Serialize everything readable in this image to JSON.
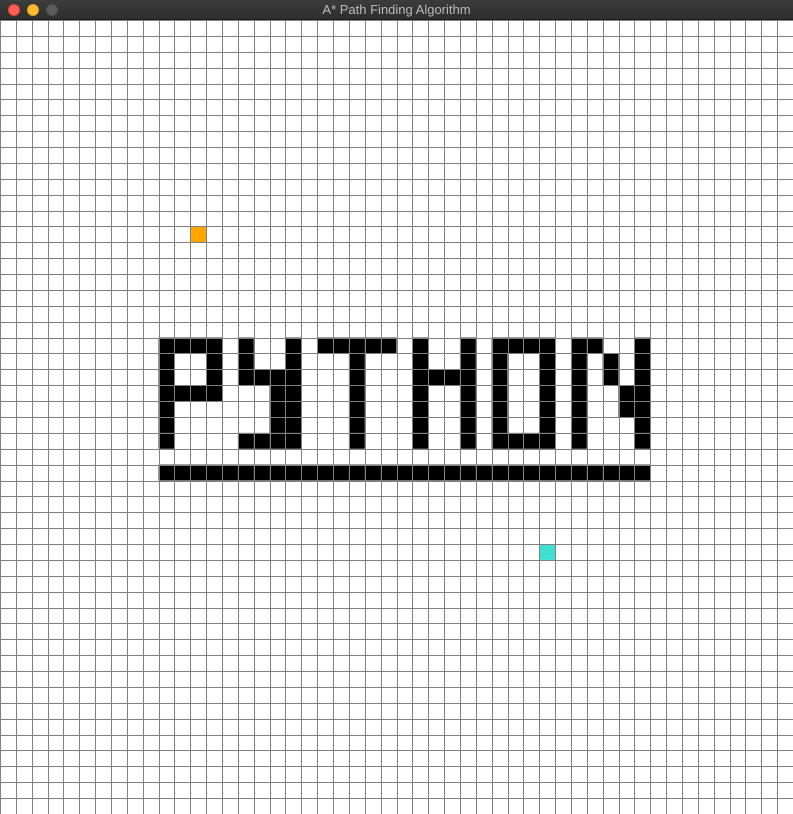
{
  "window": {
    "title": "A* Path Finding Algorithm"
  },
  "grid": {
    "rows": 50,
    "cols": 50,
    "colors": {
      "empty": "#ffffff",
      "line": "#808080",
      "barrier": "#000000",
      "start": "#ffa500",
      "end": "#40e0d0"
    },
    "start": {
      "row": 13,
      "col": 12
    },
    "end": {
      "row": 33,
      "col": 34
    },
    "barrier_rows": [
      {
        "row": 20,
        "cols": [
          [
            10,
            13
          ],
          [
            15,
            15
          ],
          [
            18,
            18
          ],
          [
            20,
            24
          ],
          [
            26,
            26
          ],
          [
            29,
            29
          ],
          [
            31,
            34
          ],
          [
            36,
            37
          ],
          [
            40,
            40
          ]
        ]
      },
      {
        "row": 21,
        "cols": [
          [
            10,
            10
          ],
          [
            13,
            13
          ],
          [
            15,
            15
          ],
          [
            18,
            18
          ],
          [
            22,
            22
          ],
          [
            26,
            26
          ],
          [
            29,
            29
          ],
          [
            31,
            31
          ],
          [
            34,
            34
          ],
          [
            36,
            36
          ],
          [
            38,
            38
          ],
          [
            40,
            40
          ]
        ]
      },
      {
        "row": 22,
        "cols": [
          [
            10,
            10
          ],
          [
            13,
            13
          ],
          [
            15,
            18
          ],
          [
            22,
            22
          ],
          [
            26,
            29
          ],
          [
            31,
            31
          ],
          [
            34,
            34
          ],
          [
            36,
            36
          ],
          [
            38,
            38
          ],
          [
            40,
            40
          ]
        ]
      },
      {
        "row": 23,
        "cols": [
          [
            10,
            13
          ],
          [
            17,
            18
          ],
          [
            22,
            22
          ],
          [
            26,
            26
          ],
          [
            29,
            29
          ],
          [
            31,
            31
          ],
          [
            34,
            34
          ],
          [
            36,
            36
          ],
          [
            39,
            40
          ]
        ]
      },
      {
        "row": 24,
        "cols": [
          [
            10,
            10
          ],
          [
            17,
            18
          ],
          [
            22,
            22
          ],
          [
            26,
            26
          ],
          [
            29,
            29
          ],
          [
            31,
            31
          ],
          [
            34,
            34
          ],
          [
            36,
            36
          ],
          [
            39,
            40
          ]
        ]
      },
      {
        "row": 25,
        "cols": [
          [
            10,
            10
          ],
          [
            17,
            18
          ],
          [
            22,
            22
          ],
          [
            26,
            26
          ],
          [
            29,
            29
          ],
          [
            31,
            31
          ],
          [
            34,
            34
          ],
          [
            36,
            36
          ],
          [
            40,
            40
          ]
        ]
      },
      {
        "row": 26,
        "cols": [
          [
            10,
            10
          ],
          [
            15,
            18
          ],
          [
            22,
            22
          ],
          [
            26,
            26
          ],
          [
            29,
            29
          ],
          [
            31,
            34
          ],
          [
            36,
            36
          ],
          [
            40,
            40
          ]
        ]
      },
      {
        "row": 28,
        "cols": [
          [
            10,
            40
          ]
        ]
      }
    ]
  }
}
